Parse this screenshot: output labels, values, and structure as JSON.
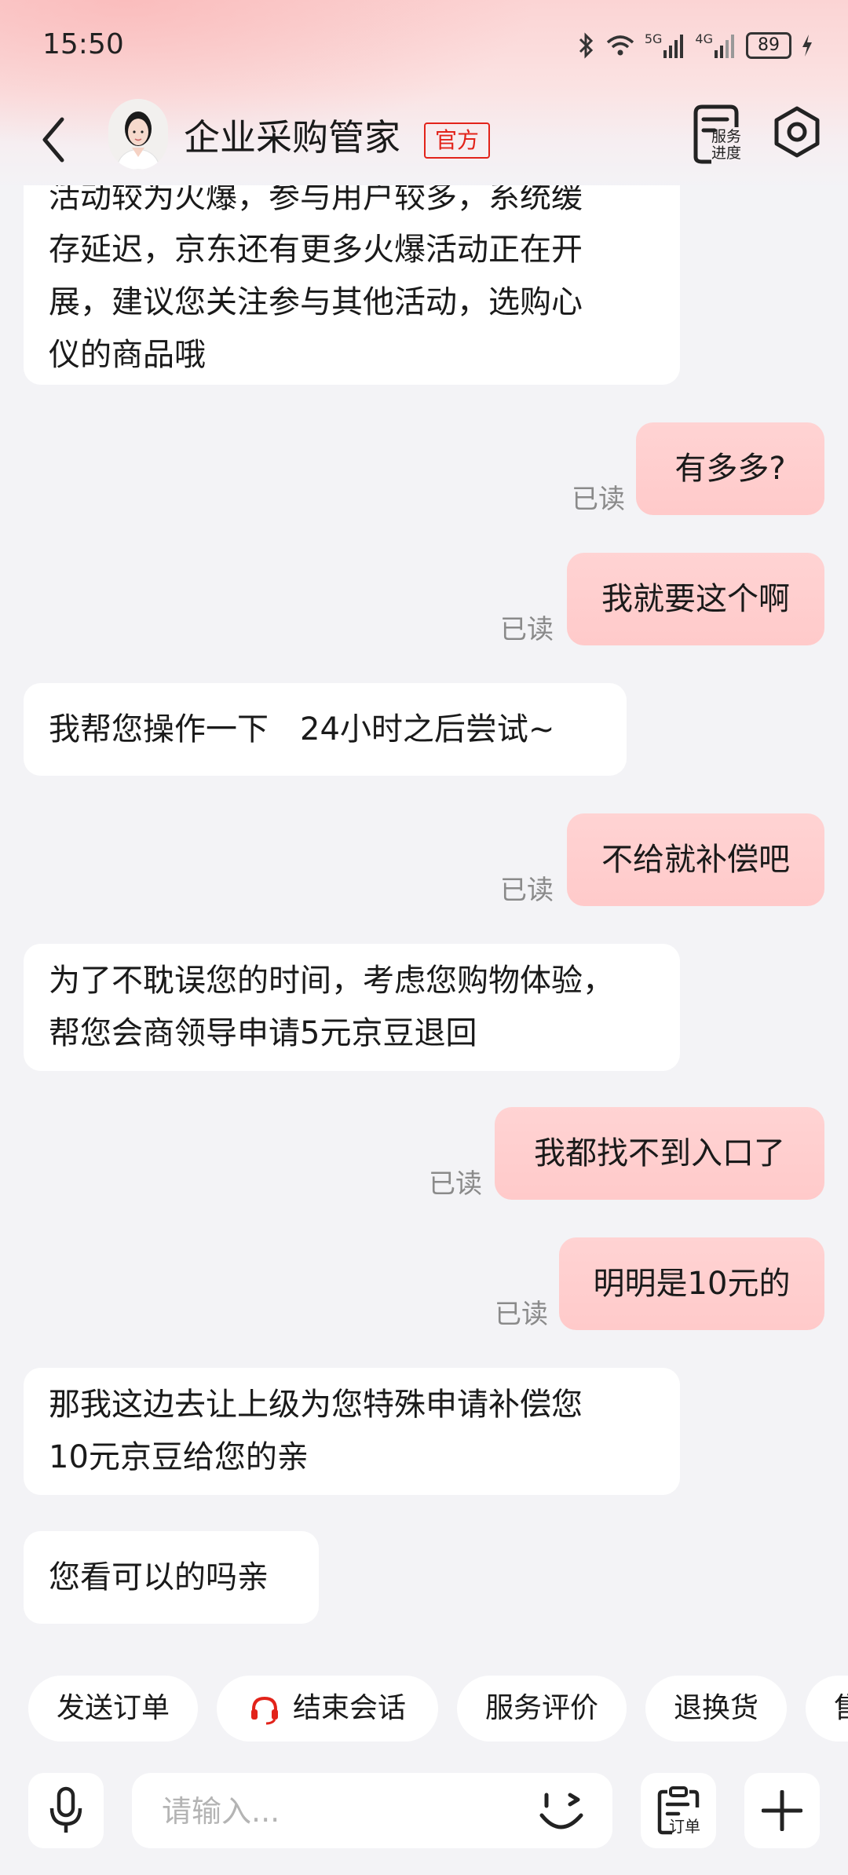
{
  "status_bar": {
    "time": "15:50",
    "network_1": "5G",
    "network_2": "4G",
    "battery": "89"
  },
  "header": {
    "title": "企业采购管家",
    "badge": "官方",
    "service_progress_label_1": "服务",
    "service_progress_label_2": "进度"
  },
  "messages": [
    {
      "side": "left",
      "lines": [
        "活动较为火爆，参与用户较多，系统缓",
        "存延迟，京东还有更多火爆活动正在开",
        "展，建议您关注参与其他活动，选购心",
        "仪的商品哦"
      ]
    },
    {
      "side": "right",
      "text": "有多多?",
      "status": "已读"
    },
    {
      "side": "right",
      "text": "我就要这个啊",
      "status": "已读"
    },
    {
      "side": "left",
      "lines": [
        "我帮您操作一下　24小时之后尝试~"
      ]
    },
    {
      "side": "right",
      "text": "不给就补偿吧",
      "status": "已读"
    },
    {
      "side": "left",
      "lines": [
        "为了不耽误您的时间，考虑您购物体验，",
        "帮您会商领导申请5元京豆退回"
      ]
    },
    {
      "side": "right",
      "text": "我都找不到入口了",
      "status": "已读"
    },
    {
      "side": "right",
      "text": "明明是10元的",
      "status": "已读"
    },
    {
      "side": "left",
      "lines": [
        "那我这边去让上级为您特殊申请补偿您",
        "10元京豆给您的亲"
      ]
    },
    {
      "side": "left",
      "lines": [
        "您看可以的吗亲"
      ]
    }
  ],
  "quick_replies": [
    {
      "label": "发送订单"
    },
    {
      "label": "结束会话",
      "icon": "headset-icon"
    },
    {
      "label": "服务评价"
    },
    {
      "label": "退换货"
    },
    {
      "label": "售"
    }
  ],
  "input_bar": {
    "placeholder": "请输入...",
    "order_label": "订单"
  },
  "colors": {
    "accent_red": "#e2231a",
    "bubble_right": "#ffcfcf",
    "bubble_left": "#ffffff",
    "background": "#f3f3f6"
  }
}
